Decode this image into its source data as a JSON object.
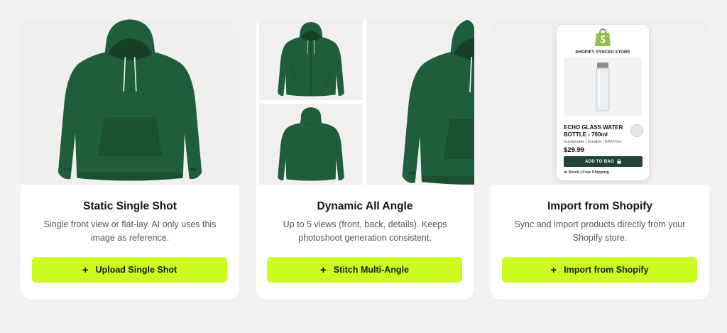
{
  "colors": {
    "page_bg": "#f3f2f0",
    "card_bg": "#ffffff",
    "cta_bg": "#ccfb22",
    "hoodie_green": "#1f5e3a",
    "shopify_green": "#95bf47",
    "add_to_bag_bg": "#1f4430"
  },
  "cards": [
    {
      "title": "Static Single Shot",
      "description": "Single front view or flat-lay. AI only uses this image as reference.",
      "cta_label": "Upload Single Shot",
      "cta_icon": "plus-icon"
    },
    {
      "title": "Dynamic All Angle",
      "description": "Up to 5 views (front, back, details). Keeps photoshoot generation consistent.",
      "cta_label": "Stitch Multi-Angle",
      "cta_icon": "plus-icon"
    },
    {
      "title": "Import from Shopify",
      "description": "Sync and import products directly from your Shopify store.",
      "cta_label": "Import from Shopify",
      "cta_icon": "plus-icon"
    }
  ],
  "shopify_preview": {
    "logo_icon": "shopify-bag-icon",
    "store_name": "SHOPIFY SYNCED STORE",
    "product_name": "ECHO GLASS WATER BOTTLE - 700ml",
    "tags": "Sustainable | Durable | BPA Free",
    "price": "$29.99",
    "add_to_bag_label": "ADD TO BAG",
    "add_to_bag_icon": "lock-icon",
    "stock_text": "In Stock | Free Shipping"
  }
}
